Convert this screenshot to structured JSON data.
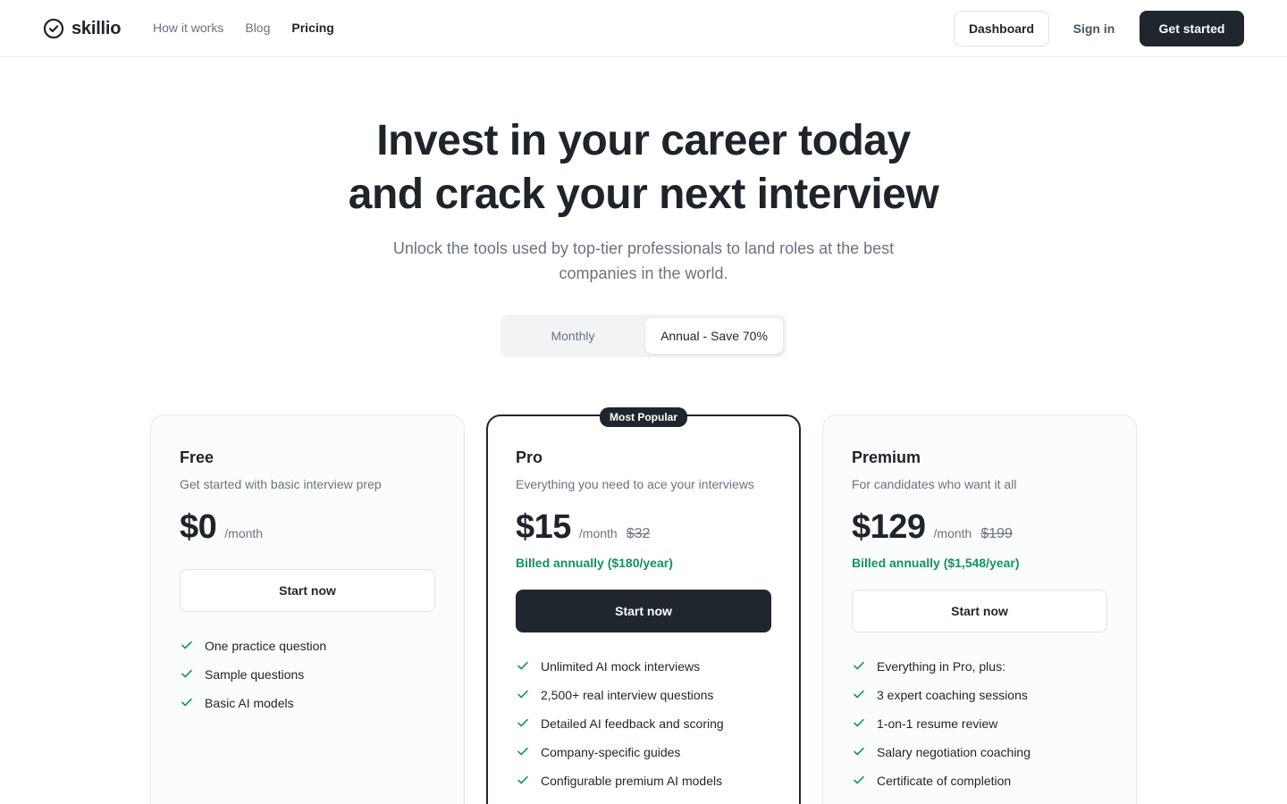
{
  "header": {
    "logo_text": "skillio",
    "nav": [
      "How it works",
      "Blog",
      "Pricing"
    ],
    "active_nav": "Pricing",
    "dashboard_label": "Dashboard",
    "signin_label": "Sign in",
    "getstarted_label": "Get started"
  },
  "hero": {
    "title_line1": "Invest in your career today",
    "title_line2": "and crack your next interview",
    "subtitle": "Unlock the tools used by top-tier professionals to land roles at the best companies in the world."
  },
  "billing_toggle": {
    "options": [
      "Monthly",
      "Annual - Save 70%"
    ],
    "selected": "Annual - Save 70%"
  },
  "plans": [
    {
      "name": "Free",
      "description": "Get started with basic interview prep",
      "price": "$0",
      "period": "/month",
      "cta": "Start now",
      "features": [
        "One practice question",
        "Sample questions",
        "Basic AI models"
      ]
    },
    {
      "name": "Pro",
      "badge": "Most Popular",
      "description": "Everything you need to ace your interviews",
      "price": "$15",
      "period": "/month",
      "old_price": "$32",
      "billed": "Billed annually ($180/year)",
      "cta": "Start now",
      "features": [
        "Unlimited AI mock interviews",
        "2,500+ real interview questions",
        "Detailed AI feedback and scoring",
        "Company-specific guides",
        "Configurable premium AI models"
      ]
    },
    {
      "name": "Premium",
      "description": "For candidates who want it all",
      "price": "$129",
      "period": "/month",
      "old_price": "$199",
      "billed": "Billed annually ($1,548/year)",
      "cta": "Start now",
      "features": [
        "Everything in Pro, plus:",
        "3 expert coaching sessions",
        "1-on-1 resume review",
        "Salary negotiation coaching",
        "Certificate of completion"
      ]
    }
  ],
  "colors": {
    "primary_dark": "#1f262e",
    "accent_green": "#12945c",
    "muted_text": "#6b7280"
  },
  "icons": {
    "logo": "check-circle-icon",
    "feature": "check-icon"
  }
}
